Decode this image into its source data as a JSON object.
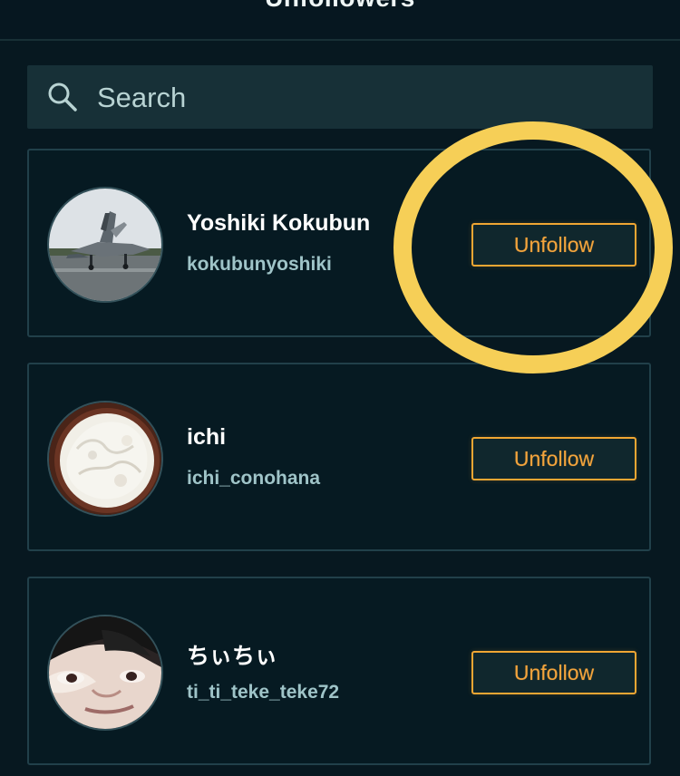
{
  "header": {
    "title": "Unfollowers",
    "back_icon": "back-chevron-icon"
  },
  "search": {
    "placeholder": "Search",
    "icon": "search-icon"
  },
  "users": [
    {
      "name": "Yoshiki Kokubun",
      "handle": "kokubunyoshiki",
      "button_label": "Unfollow",
      "avatar_icon": "jet-photo-avatar"
    },
    {
      "name": "ichi",
      "handle": "ichi_conohana",
      "button_label": "Unfollow",
      "avatar_icon": "rice-bowl-avatar"
    },
    {
      "name": "ちぃちぃ",
      "handle": "ti_ti_teke_teke72",
      "button_label": "Unfollow",
      "avatar_icon": "face-portrait-avatar"
    }
  ],
  "colors": {
    "background": "#071820",
    "card_border": "#21404a",
    "accent_orange": "#f0a633",
    "highlight_yellow": "#f6cf57",
    "handle_color": "#9fc4c8"
  }
}
